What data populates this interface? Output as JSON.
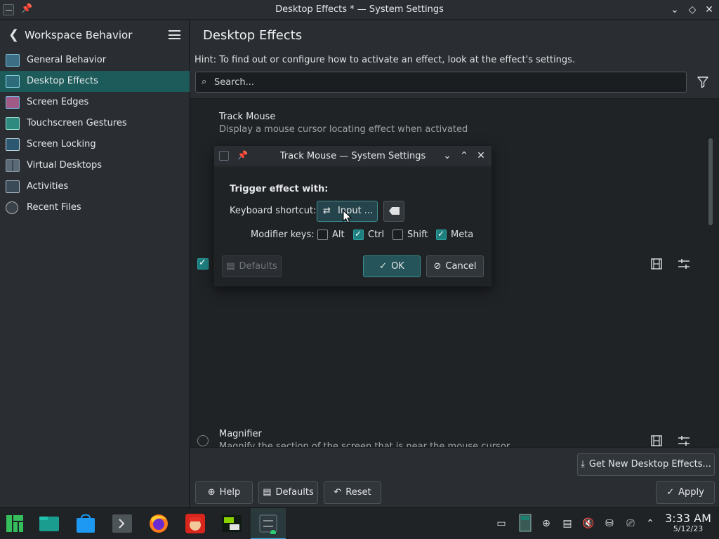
{
  "window": {
    "title": "Desktop Effects * — System Settings"
  },
  "sidebar": {
    "header": "Workspace Behavior",
    "items": [
      {
        "label": "General Behavior",
        "active": false
      },
      {
        "label": "Desktop Effects",
        "active": true
      },
      {
        "label": "Screen Edges",
        "active": false
      },
      {
        "label": "Touchscreen Gestures",
        "active": false
      },
      {
        "label": "Screen Locking",
        "active": false
      },
      {
        "label": "Virtual Desktops",
        "active": false
      },
      {
        "label": "Activities",
        "active": false
      },
      {
        "label": "Recent Files",
        "active": false
      }
    ]
  },
  "main": {
    "title": "Desktop Effects",
    "hint": "Hint: To find out or configure how to activate an effect, look at the effect's settings.",
    "search_placeholder": "Search...",
    "effects": [
      {
        "name": "Track Mouse",
        "description": "Display a mouse cursor locating effect when activated",
        "enabled": true
      },
      {
        "name": "Magnifier",
        "description": "Magnify the section of the screen that is near the mouse cursor",
        "enabled": false
      }
    ]
  },
  "footer": {
    "get_new": "Get New Desktop Effects...",
    "help": "Help",
    "defaults": "Defaults",
    "reset": "Reset",
    "apply": "Apply"
  },
  "dialog": {
    "title": "Track Mouse — System Settings",
    "trigger_label": "Trigger effect with:",
    "shortcut_label": "Keyboard shortcut:",
    "shortcut_button": "Input ...",
    "modifier_label": "Modifier keys:",
    "modifiers": [
      {
        "label": "Alt",
        "checked": false
      },
      {
        "label": "Ctrl",
        "checked": true
      },
      {
        "label": "Shift",
        "checked": false
      },
      {
        "label": "Meta",
        "checked": true
      }
    ],
    "defaults": "Defaults",
    "ok": "OK",
    "cancel": "Cancel"
  },
  "taskbar": {
    "time": "3:33 AM",
    "date": "5/12/23"
  },
  "colors": {
    "accent": "#1d5b5b",
    "check": "#1e7f7f",
    "highlight": "#3daee9"
  }
}
